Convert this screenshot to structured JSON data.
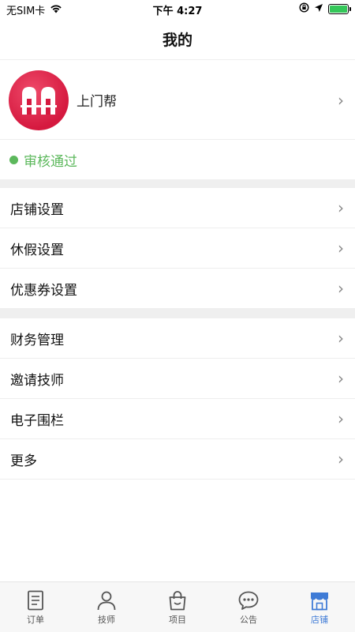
{
  "status_bar": {
    "carrier": "无SIM卡",
    "time": "下午 4:27"
  },
  "nav": {
    "title": "我的"
  },
  "profile": {
    "name": "上门帮"
  },
  "review": {
    "text": "审核通过",
    "color": "#5cb85c"
  },
  "menu_group1": [
    {
      "label": "店铺设置"
    },
    {
      "label": "休假设置"
    },
    {
      "label": "优惠券设置"
    }
  ],
  "menu_group2": [
    {
      "label": "财务管理"
    },
    {
      "label": "邀请技师"
    },
    {
      "label": "电子围栏"
    },
    {
      "label": "更多"
    }
  ],
  "tabbar": [
    {
      "label": "订单",
      "icon": "order-icon"
    },
    {
      "label": "技师",
      "icon": "person-icon"
    },
    {
      "label": "项目",
      "icon": "bag-icon"
    },
    {
      "label": "公告",
      "icon": "chat-bubble-icon"
    },
    {
      "label": "店铺",
      "icon": "store-icon",
      "active": true
    }
  ],
  "colors": {
    "accent": "#3f7bd6",
    "avatar": "#d5193f"
  }
}
